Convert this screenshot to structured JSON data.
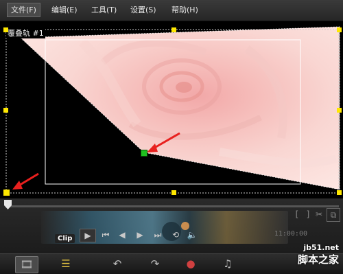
{
  "menu": {
    "items": [
      {
        "label": "文件(F)"
      },
      {
        "label": "编辑(E)"
      },
      {
        "label": "工具(T)"
      },
      {
        "label": "设置(S)"
      },
      {
        "label": "帮助(H)"
      }
    ]
  },
  "preview": {
    "track_label": "覆叠轨 #1",
    "image_subject": "pink rose"
  },
  "player": {
    "clip_label": "Clip",
    "timecode": "11:00:00",
    "controls": [
      "play",
      "to-start",
      "prev-frame",
      "next-frame",
      "to-end",
      "repeat",
      "volume"
    ]
  },
  "watermark": {
    "url": "jb51.net",
    "name": "脚本之家"
  },
  "colors": {
    "handle": "#ffe800",
    "control_point": "#20c020",
    "arrow": "#e8201e",
    "menu_bg": "#2e2e2e"
  }
}
